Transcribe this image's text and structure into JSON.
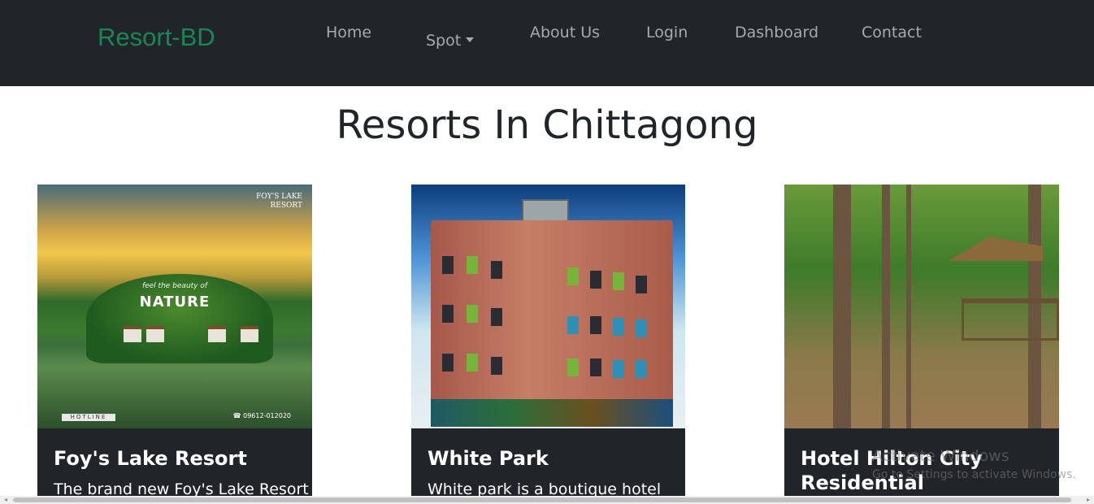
{
  "navbar": {
    "brand": "Resort-BD",
    "brand_color": "#198754",
    "links": [
      {
        "label": "Home"
      },
      {
        "label": "Spot"
      },
      {
        "label": "About Us"
      },
      {
        "label": "Login"
      },
      {
        "label": "Dashboard"
      },
      {
        "label": "Contact"
      }
    ]
  },
  "main": {
    "title": "Resorts In Chittagong",
    "cards": [
      {
        "title": "Foy's Lake Resort",
        "text": "The brand new Foy's Lake Resort",
        "image": {
          "tagline": "feel the beauty of",
          "headline": "NATURE",
          "logo_line1": "FOY'S LAKE",
          "logo_line2": "RESORT",
          "hotline": "HOTLINE",
          "phone": "09612-012020"
        }
      },
      {
        "title": "White Park",
        "text": "White park is a boutique hotel",
        "image": {}
      },
      {
        "title": "Hotel Hilton City Residential",
        "text": "",
        "image": {}
      }
    ]
  },
  "watermark": {
    "line1": "Activate Windows",
    "line2": "Go to Settings to activate Windows."
  },
  "scrollbar": {
    "left_arrow": "◂",
    "right_arrow": "▸"
  }
}
